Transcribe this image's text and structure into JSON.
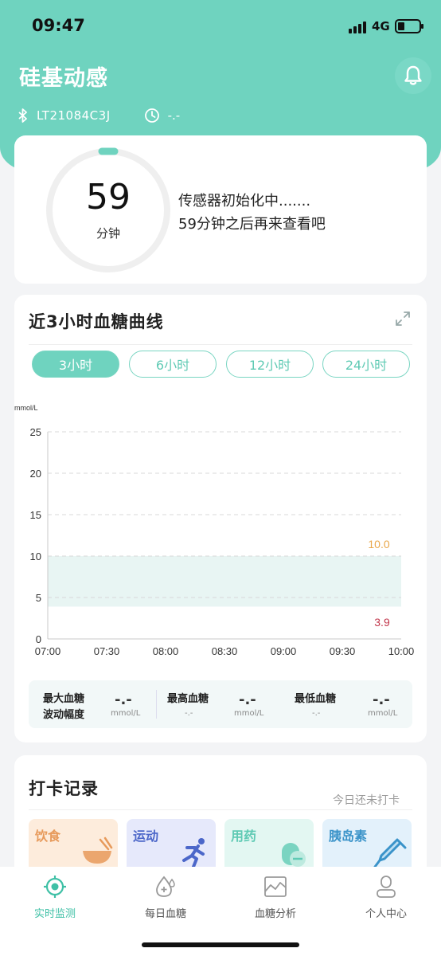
{
  "status_bar": {
    "time": "09:47",
    "network": "4G"
  },
  "header": {
    "app_title": "硅基动感",
    "device_id": "LT21084C3J",
    "time_remaining": "-.-",
    "icons": [
      "bell-icon",
      "bluetooth-icon",
      "clock-icon"
    ]
  },
  "sensor": {
    "countdown_value": "59",
    "countdown_unit": "分钟",
    "message_line1": "传感器初始化中.......",
    "message_line2": "59分钟之后再来查看吧"
  },
  "curve": {
    "title": "近3小时血糖曲线",
    "tabs": [
      {
        "label": "3小时",
        "active": true
      },
      {
        "label": "6小时",
        "active": false
      },
      {
        "label": "12小时",
        "active": false
      },
      {
        "label": "24小时",
        "active": false
      }
    ],
    "unit_label": "mmol/L",
    "upper_label": "10.0",
    "lower_label": "3.9",
    "colors": {
      "accent": "#6fd3bf",
      "upper": "#e9a74a",
      "lower": "#c2364b",
      "band": "#e8f5f3"
    }
  },
  "chart_data": {
    "type": "line",
    "title": "近3小时血糖曲线",
    "ylabel": "mmol/L",
    "xlabel": "",
    "x": [
      "07:00",
      "07:30",
      "08:00",
      "08:30",
      "09:00",
      "09:30",
      "10:00"
    ],
    "y_ticks": [
      "0",
      "5",
      "10",
      "15",
      "20",
      "25"
    ],
    "ylim": [
      0,
      25
    ],
    "series": [],
    "target_range": {
      "low": 3.9,
      "high": 10.0
    },
    "grid": "horizontal dashed"
  },
  "stats": {
    "max_label_1": "最大血糖",
    "max_label_2": "波动幅度",
    "max_value": "-.-",
    "max_unit": "mmol/L",
    "highest_label": "最高血糖",
    "highest_value": "-.-",
    "highest_sub": "-.-",
    "highest_unit": "mmol/L",
    "lowest_label": "最低血糖",
    "lowest_value": "-.-",
    "lowest_sub": "-.-",
    "lowest_unit": "mmol/L"
  },
  "checkin": {
    "title": "打卡记录",
    "subtitle": "今日还未打卡",
    "tiles": [
      {
        "label": "饮食",
        "icon": "bowl-icon",
        "color": "#e79a5b",
        "bg": "#fdecdc"
      },
      {
        "label": "运动",
        "icon": "running-icon",
        "color": "#4c67c9",
        "bg": "#e6e9fb"
      },
      {
        "label": "用药",
        "icon": "pill-icon",
        "color": "#5fcab4",
        "bg": "#e3f7f2"
      },
      {
        "label": "胰岛素",
        "icon": "syringe-icon",
        "color": "#3a93c9",
        "bg": "#e3f1fb"
      }
    ]
  },
  "tabbar": {
    "items": [
      {
        "label": "实时监测",
        "icon": "target-icon",
        "active": true
      },
      {
        "label": "每日血糖",
        "icon": "drop-icon",
        "active": false
      },
      {
        "label": "血糖分析",
        "icon": "chart-icon",
        "active": false
      },
      {
        "label": "个人中心",
        "icon": "person-icon",
        "active": false
      }
    ]
  }
}
